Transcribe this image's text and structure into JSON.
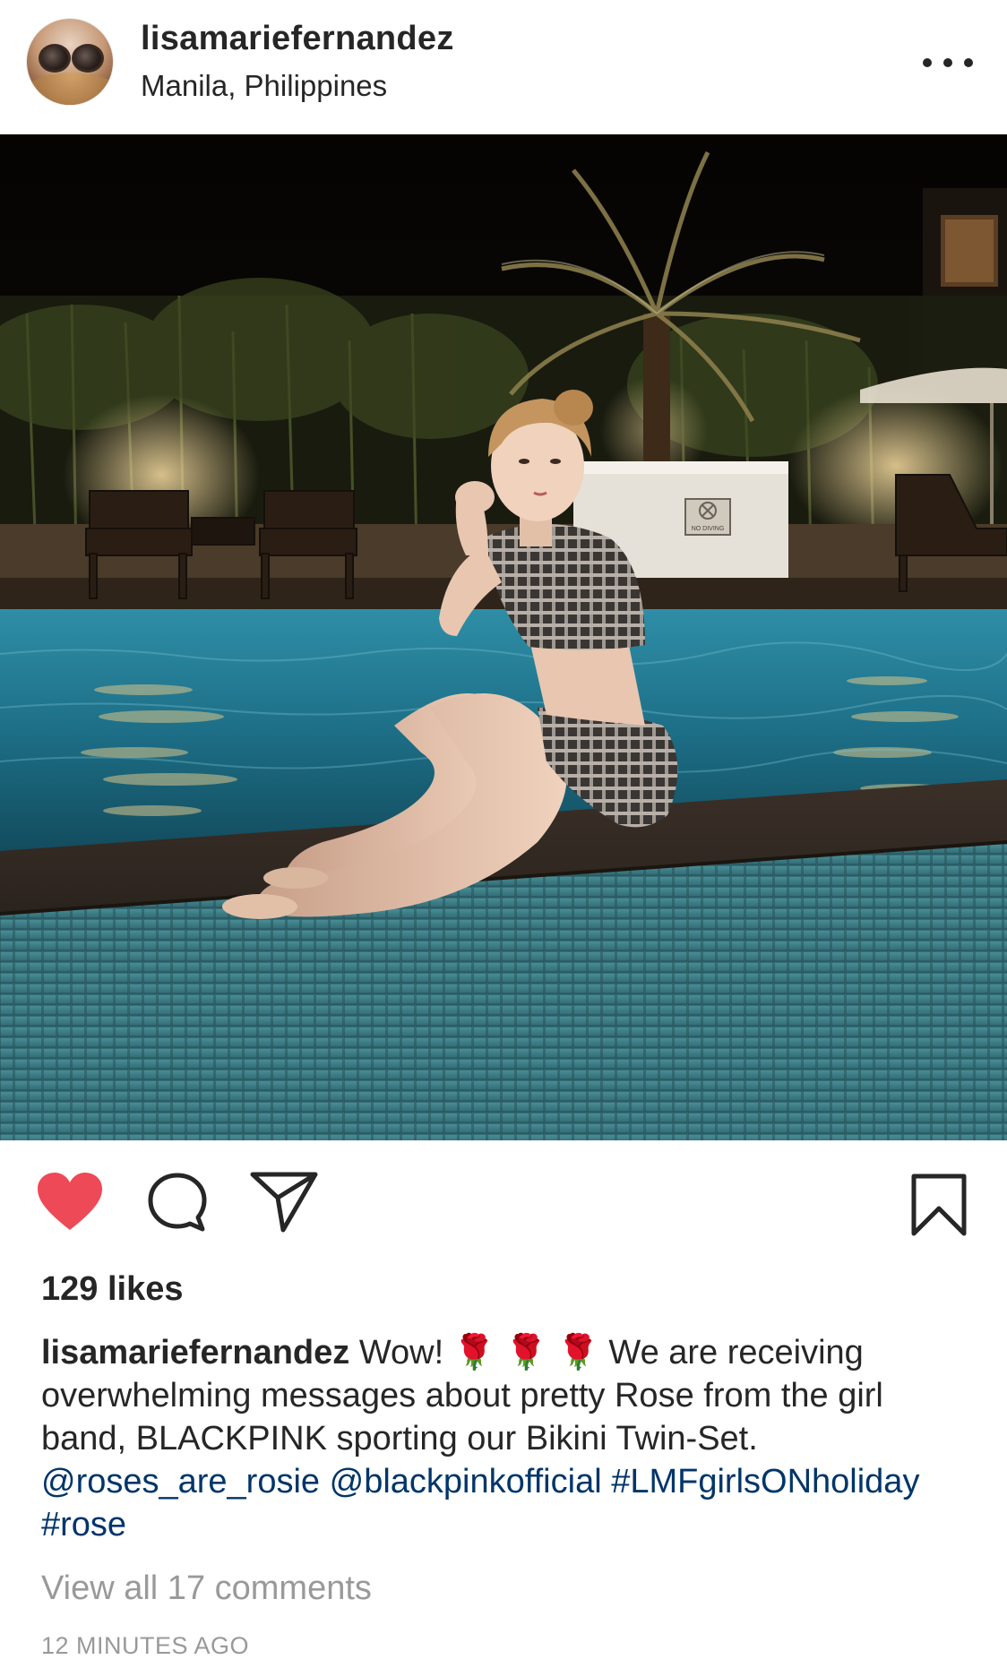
{
  "header": {
    "username": "lisamariefernandez",
    "location": "Manila, Philippines"
  },
  "photo": {
    "sign_text": "NO DIVING"
  },
  "actions": {
    "like_color": "#ed4956",
    "icons": [
      "heart-icon",
      "comment-icon",
      "share-icon",
      "bookmark-icon"
    ]
  },
  "likes": "129 likes",
  "caption": {
    "username": "lisamariefernandez",
    "text_1": "Wow!",
    "emoji": [
      "🌹",
      "🌹",
      "🌹"
    ],
    "text_2": "We are receiving overwhelming messages about pretty Rose from the girl band, BLACKPINK sporting our Bikini Twin-Set.",
    "mentions": [
      "@roses_are_rosie",
      "@blackpinkofficial"
    ],
    "hashtags": [
      "#LMFgirlsONholiday",
      "#rose"
    ]
  },
  "comments_link": "View all 17 comments",
  "timestamp": "12 MINUTES AGO",
  "colors": {
    "text": "#262626",
    "link": "#003569",
    "muted": "#999999"
  }
}
